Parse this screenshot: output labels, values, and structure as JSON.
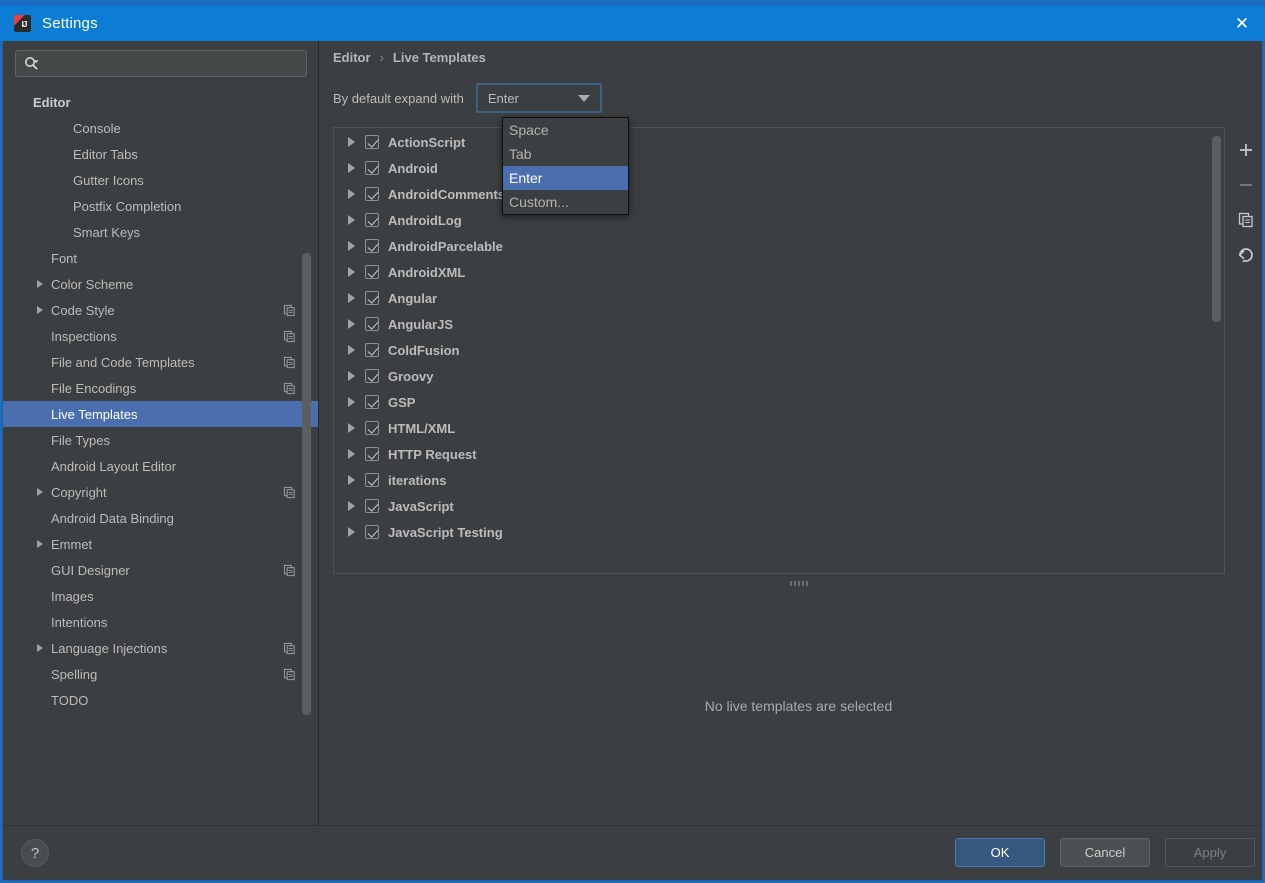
{
  "window": {
    "title": "Settings",
    "logo_icon": "intellij-idea-logo",
    "close_icon": "close-icon"
  },
  "sidebar": {
    "search": {
      "placeholder": "",
      "value": "",
      "icon": "search-icon",
      "dropdown_icon": "chevron-down-icon"
    },
    "items": [
      {
        "label": "Editor",
        "indent": 0,
        "group": true,
        "arrow": false,
        "selected": false,
        "copy": false
      },
      {
        "label": "Console",
        "indent": 2,
        "group": false,
        "arrow": false,
        "selected": false,
        "copy": false
      },
      {
        "label": "Editor Tabs",
        "indent": 2,
        "group": false,
        "arrow": false,
        "selected": false,
        "copy": false
      },
      {
        "label": "Gutter Icons",
        "indent": 2,
        "group": false,
        "arrow": false,
        "selected": false,
        "copy": false
      },
      {
        "label": "Postfix Completion",
        "indent": 2,
        "group": false,
        "arrow": false,
        "selected": false,
        "copy": false
      },
      {
        "label": "Smart Keys",
        "indent": 2,
        "group": false,
        "arrow": false,
        "selected": false,
        "copy": false
      },
      {
        "label": "Font",
        "indent": 1,
        "group": false,
        "arrow": false,
        "selected": false,
        "copy": false
      },
      {
        "label": "Color Scheme",
        "indent": 1,
        "group": false,
        "arrow": true,
        "selected": false,
        "copy": false
      },
      {
        "label": "Code Style",
        "indent": 1,
        "group": false,
        "arrow": true,
        "selected": false,
        "copy": true
      },
      {
        "label": "Inspections",
        "indent": 1,
        "group": false,
        "arrow": false,
        "selected": false,
        "copy": true
      },
      {
        "label": "File and Code Templates",
        "indent": 1,
        "group": false,
        "arrow": false,
        "selected": false,
        "copy": true
      },
      {
        "label": "File Encodings",
        "indent": 1,
        "group": false,
        "arrow": false,
        "selected": false,
        "copy": true
      },
      {
        "label": "Live Templates",
        "indent": 1,
        "group": false,
        "arrow": false,
        "selected": true,
        "copy": false
      },
      {
        "label": "File Types",
        "indent": 1,
        "group": false,
        "arrow": false,
        "selected": false,
        "copy": false
      },
      {
        "label": "Android Layout Editor",
        "indent": 1,
        "group": false,
        "arrow": false,
        "selected": false,
        "copy": false
      },
      {
        "label": "Copyright",
        "indent": 1,
        "group": false,
        "arrow": true,
        "selected": false,
        "copy": true
      },
      {
        "label": "Android Data Binding",
        "indent": 1,
        "group": false,
        "arrow": false,
        "selected": false,
        "copy": false
      },
      {
        "label": "Emmet",
        "indent": 1,
        "group": false,
        "arrow": true,
        "selected": false,
        "copy": false
      },
      {
        "label": "GUI Designer",
        "indent": 1,
        "group": false,
        "arrow": false,
        "selected": false,
        "copy": true
      },
      {
        "label": "Images",
        "indent": 1,
        "group": false,
        "arrow": false,
        "selected": false,
        "copy": false
      },
      {
        "label": "Intentions",
        "indent": 1,
        "group": false,
        "arrow": false,
        "selected": false,
        "copy": false
      },
      {
        "label": "Language Injections",
        "indent": 1,
        "group": false,
        "arrow": true,
        "selected": false,
        "copy": true
      },
      {
        "label": "Spelling",
        "indent": 1,
        "group": false,
        "arrow": false,
        "selected": false,
        "copy": true
      },
      {
        "label": "TODO",
        "indent": 1,
        "group": false,
        "arrow": false,
        "selected": false,
        "copy": false
      }
    ]
  },
  "breadcrumb": {
    "root": "Editor",
    "separator": "›",
    "current": "Live Templates"
  },
  "expand_with": {
    "label": "By default expand with",
    "selected": "Enter",
    "options": [
      "Space",
      "Tab",
      "Enter",
      "Custom..."
    ],
    "dropdown_open": true,
    "highlighted": "Enter"
  },
  "template_groups": [
    {
      "label": "ActionScript",
      "checked": true
    },
    {
      "label": "Android",
      "checked": true
    },
    {
      "label": "AndroidComments",
      "checked": true
    },
    {
      "label": "AndroidLog",
      "checked": true
    },
    {
      "label": "AndroidParcelable",
      "checked": true
    },
    {
      "label": "AndroidXML",
      "checked": true
    },
    {
      "label": "Angular",
      "checked": true
    },
    {
      "label": "AngularJS",
      "checked": true
    },
    {
      "label": "ColdFusion",
      "checked": true
    },
    {
      "label": "Groovy",
      "checked": true
    },
    {
      "label": "GSP",
      "checked": true
    },
    {
      "label": "HTML/XML",
      "checked": true
    },
    {
      "label": "HTTP Request",
      "checked": true
    },
    {
      "label": "iterations",
      "checked": true
    },
    {
      "label": "JavaScript",
      "checked": true
    },
    {
      "label": "JavaScript Testing",
      "checked": true
    }
  ],
  "side_toolbar": [
    {
      "name": "add-button",
      "icon": "plus-icon",
      "enabled": true
    },
    {
      "name": "remove-button",
      "icon": "minus-icon",
      "enabled": false
    },
    {
      "name": "duplicate-button",
      "icon": "copy-icon",
      "enabled": true
    },
    {
      "name": "revert-button",
      "icon": "undo-arrow-icon",
      "enabled": true
    }
  ],
  "detail": {
    "empty_message": "No live templates are selected"
  },
  "footer": {
    "help_label": "?",
    "ok_label": "OK",
    "cancel_label": "Cancel",
    "apply_label": "Apply",
    "apply_enabled": false
  },
  "colors": {
    "titlebar": "#0c7cd5",
    "background": "#3c3f41",
    "selection": "#4b6eaf",
    "accent_button": "#365880",
    "text": "#bbbbbb"
  }
}
